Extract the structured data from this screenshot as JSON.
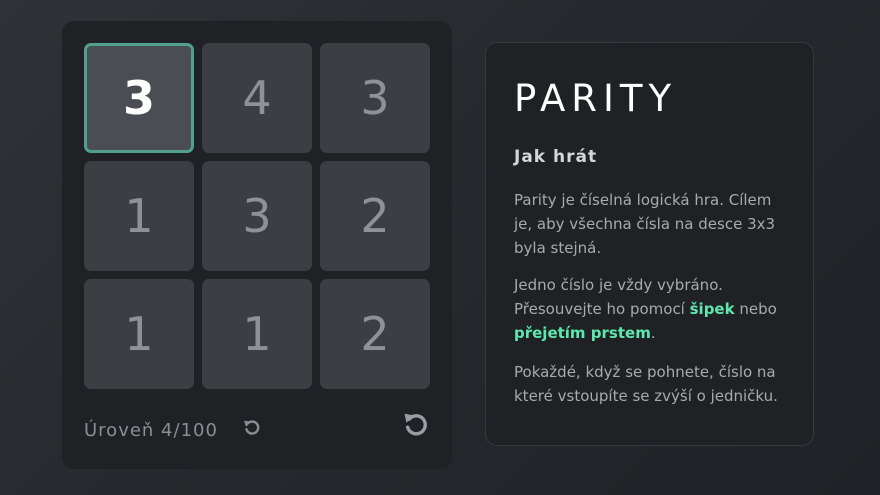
{
  "board": {
    "tiles": [
      "3",
      "4",
      "3",
      "1",
      "3",
      "2",
      "1",
      "1",
      "2"
    ],
    "selected_index": 0
  },
  "footer": {
    "level_label": "Úroveň 4/100"
  },
  "info": {
    "title": "PARITY",
    "subtitle": "Jak hrát",
    "p1": "Parity je číselná logická hra. Cílem je, aby všechna čísla na desce 3x3 byla stejná.",
    "p2_a": "Jedno číslo je vždy vybráno. Přesouvejte ho pomocí ",
    "p2_highlight1": "šipek",
    "p2_b": " nebo ",
    "p2_highlight2": "přejetím prstem",
    "p2_c": ".",
    "p3": "Pokaždé, když se pohnete, číslo na které vstoupíte se zvýší o jedničku."
  },
  "colors": {
    "background": "#2a2d31",
    "panel": "#1f2124",
    "tile": "#3b3e43",
    "selected_tile": "#4a4e54",
    "selected_border": "#4fa18c",
    "highlight": "#5ee8b0"
  },
  "icons": {
    "small_reset": "undo-icon",
    "big_reset": "restart-icon"
  }
}
